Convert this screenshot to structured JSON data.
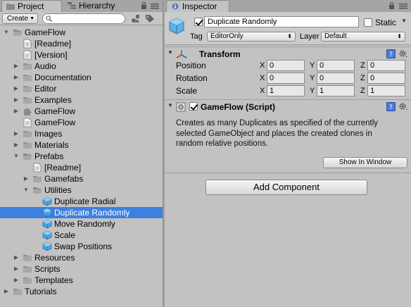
{
  "project_tab": {
    "label": "Project"
  },
  "hierarchy_tab": {
    "label": "Hierarchy"
  },
  "project_toolbar": {
    "create_label": "Create",
    "search_value": "",
    "search_placeholder": ""
  },
  "tree": [
    {
      "label": "GameFlow",
      "icon": "folder-open-icon",
      "expanded": true
    },
    {
      "label": "[Readme]",
      "icon": "text-file-icon"
    },
    {
      "label": "[Version]",
      "icon": "text-file-icon"
    },
    {
      "label": "Audio",
      "icon": "folder-icon",
      "expanded": false
    },
    {
      "label": "Documentation",
      "icon": "folder-icon",
      "expanded": false
    },
    {
      "label": "Editor",
      "icon": "folder-icon",
      "expanded": false
    },
    {
      "label": "Examples",
      "icon": "folder-icon",
      "expanded": false
    },
    {
      "label": "GameFlow",
      "icon": "puzzle-icon",
      "expanded": false
    },
    {
      "label": "GameFlow",
      "icon": "text-file-icon"
    },
    {
      "label": "Images",
      "icon": "folder-icon",
      "expanded": false
    },
    {
      "label": "Materials",
      "icon": "folder-icon",
      "expanded": false
    },
    {
      "label": "Prefabs",
      "icon": "folder-open-icon",
      "expanded": true
    },
    {
      "label": "[Readme]",
      "icon": "text-file-icon"
    },
    {
      "label": "Gamefabs",
      "icon": "folder-icon",
      "expanded": false
    },
    {
      "label": "Utilities",
      "icon": "folder-open-icon",
      "expanded": true
    },
    {
      "label": "Duplicate Radial",
      "icon": "prefab-cube-icon"
    },
    {
      "label": "Duplicate Randomly",
      "icon": "prefab-cube-icon",
      "selected": true
    },
    {
      "label": "Move Randomly",
      "icon": "prefab-cube-icon"
    },
    {
      "label": "Scale",
      "icon": "prefab-cube-icon"
    },
    {
      "label": "Swap Positions",
      "icon": "prefab-cube-icon"
    },
    {
      "label": "Resources",
      "icon": "folder-icon",
      "expanded": false
    },
    {
      "label": "Scripts",
      "icon": "folder-icon",
      "expanded": false
    },
    {
      "label": "Templates",
      "icon": "folder-icon",
      "expanded": false
    },
    {
      "label": "Tutorials",
      "icon": "folder-icon",
      "expanded": false
    }
  ],
  "inspector_tab": {
    "label": "Inspector"
  },
  "inspector": {
    "object_name": "Duplicate Randomly",
    "active": true,
    "static_label": "Static",
    "static_checked": false,
    "tag_label": "Tag",
    "tag_value": "EditorOnly",
    "layer_label": "Layer",
    "layer_value": "Default"
  },
  "transform": {
    "title": "Transform",
    "rows": [
      {
        "label": "Position",
        "x": "0",
        "y": "0",
        "z": "0"
      },
      {
        "label": "Rotation",
        "x": "0",
        "y": "0",
        "z": "0"
      },
      {
        "label": "Scale",
        "x": "1",
        "y": "1",
        "z": "1"
      }
    ],
    "axis_labels": [
      "X",
      "Y",
      "Z"
    ]
  },
  "script_component": {
    "title": "GameFlow (Script)",
    "enabled": true,
    "description": "Creates as many Duplicates as specified of the currently selected GameObject and places the created clones in random relative positions.",
    "show_in_window_label": "Show In Window"
  },
  "add_component_label": "Add Component",
  "colors": {
    "selection": "#3d80df",
    "panel": "#c2c2c2",
    "folder": "#8f8f8f",
    "prefab": "#4aa3e0"
  }
}
